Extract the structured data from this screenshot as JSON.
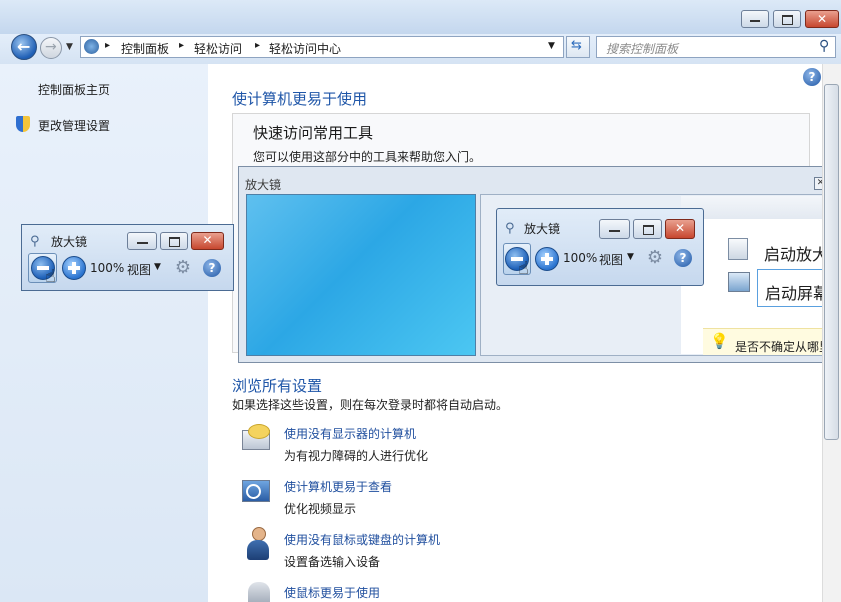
{
  "window": {
    "search_placeholder": "搜索控制面板",
    "breadcrumb": [
      "控制面板",
      "轻松访问",
      "轻松访问中心"
    ]
  },
  "sidebar": {
    "home_link": "控制面板主页",
    "admin_link": "更改管理设置"
  },
  "main": {
    "heading": "使计算机更易于使用",
    "quick_title": "快速访问常用工具",
    "quick_desc": "您可以使用这部分中的工具来帮助您入门。",
    "browse_title": "浏览所有设置",
    "browse_desc": "如果选择这些设置，则在每次登录时都将自动启动。",
    "items": [
      {
        "title": "使用没有显示器的计算机",
        "desc": "为有视力障碍的人进行优化"
      },
      {
        "title": "使计算机更易于查看",
        "desc": "优化视频显示"
      },
      {
        "title": "使用没有鼠标或键盘的计算机",
        "desc": "设置备选输入设备"
      },
      {
        "title": "使鼠标更易于使用",
        "desc": ""
      }
    ]
  },
  "lens": {
    "title": "放大镜",
    "start_magnifier": "启动放大",
    "start_narrator": "启动屏幕",
    "hint": "是否不确定从哪里"
  },
  "magnifier": {
    "title": "放大镜",
    "zoom": "100%",
    "view_label": "视图"
  }
}
